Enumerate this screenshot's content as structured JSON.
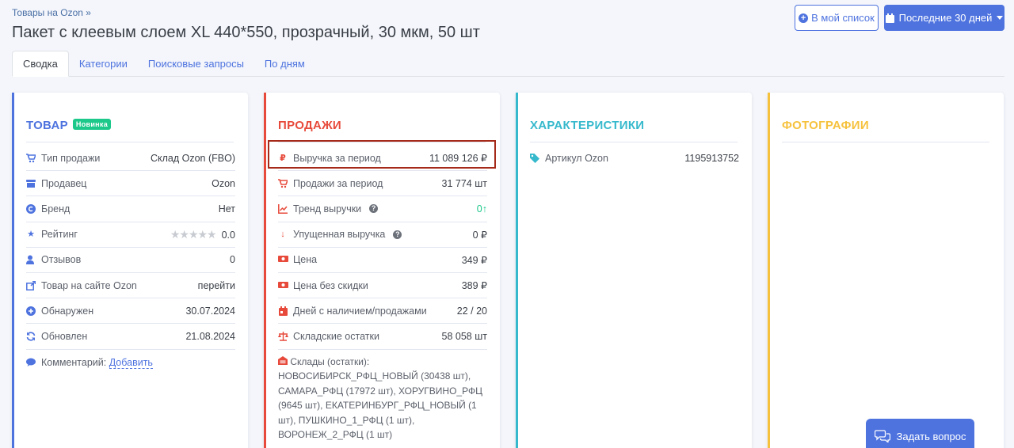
{
  "breadcrumb": "Товары на Ozon »",
  "title": "Пакет с клеевым слоем XL 440*550, прозрачный, 30 мкм, 50 шт",
  "buttons": {
    "my_list": "В мой список",
    "period": "Последние 30 дней"
  },
  "tabs": [
    "Сводка",
    "Категории",
    "Поисковые запросы",
    "По дням"
  ],
  "colors": {
    "accent": "#4e73df",
    "product": "#4e73df",
    "sales": "#e74a3b",
    "specs": "#36b9cc",
    "photos": "#f6c23e",
    "badge": "#1cc88a",
    "highlight": "#a52a1a"
  },
  "product": {
    "title": "ТОВАР",
    "badge": "Новинка",
    "rows": [
      {
        "label": "Тип продажи",
        "value": "Склад Ozon (FBO)",
        "icon": "cart-icon"
      },
      {
        "label": "Продавец",
        "value": "Ozon",
        "icon": "store-icon"
      },
      {
        "label": "Бренд",
        "value": "Нет",
        "icon": "copyright-icon"
      },
      {
        "label": "Рейтинг",
        "value": "0.0",
        "icon": "star-icon"
      },
      {
        "label": "Отзывов",
        "value": "0",
        "icon": "user-edit-icon"
      },
      {
        "label": "Товар на сайте Ozon",
        "value": "перейти",
        "icon": "external-link-icon"
      },
      {
        "label": "Обнаружен",
        "value": "30.07.2024",
        "icon": "plus-circle-icon"
      },
      {
        "label": "Обновлен",
        "value": "21.08.2024",
        "icon": "sync-icon"
      }
    ],
    "comment_label": "Комментарий:",
    "comment_link": "Добавить"
  },
  "sales": {
    "title": "ПРОДАЖИ",
    "rows": [
      {
        "label": "Выручка за период",
        "value": "11 089 126 ₽",
        "icon": "ruble-icon"
      },
      {
        "label": "Продажи за период",
        "value": "31 774 шт",
        "icon": "cart-icon"
      },
      {
        "label": "Тренд выручки",
        "value": "0↑",
        "icon": "chart-line-icon"
      },
      {
        "label": "Упущенная выручка",
        "value": "0 ₽",
        "icon": "arrow-down-icon"
      },
      {
        "label": "Цена",
        "value": "349 ₽",
        "icon": "money-icon"
      },
      {
        "label": "Цена без скидки",
        "value": "389 ₽",
        "icon": "money-icon"
      },
      {
        "label": "Дней с наличием/продажами",
        "value": "22 / 20",
        "icon": "calendar-icon"
      },
      {
        "label": "Складские остатки",
        "value": "58 058 шт",
        "icon": "balance-icon"
      }
    ],
    "warehouses_label": "Склады (остатки):",
    "warehouses": [
      {
        "name": "НОВОСИБИРСК_РФЦ_НОВЫЙ",
        "qty": "(30438 шт),"
      },
      {
        "name": "САМАРА_РФЦ",
        "qty": "(17972 шт),"
      },
      {
        "name": "ХОРУГВИНО_РФЦ",
        "qty": "(9645 шт),"
      },
      {
        "name": "ЕКАТЕРИНБУРГ_РФЦ_НОВЫЙ",
        "qty": "(1 шт),"
      },
      {
        "name": "ПУШКИНО_1_РФЦ",
        "qty": "(1 шт),"
      },
      {
        "name": "ВОРОНЕЖ_2_РФЦ",
        "qty": "(1 шт)"
      }
    ]
  },
  "specs": {
    "title": "ХАРАКТЕРИСТИКИ",
    "rows": [
      {
        "label": "Артикул Ozon",
        "value": "1195913752",
        "icon": "tag-icon"
      }
    ]
  },
  "photos": {
    "title": "ФОТОГРАФИИ"
  },
  "chat": {
    "label": "Задать вопрос"
  }
}
